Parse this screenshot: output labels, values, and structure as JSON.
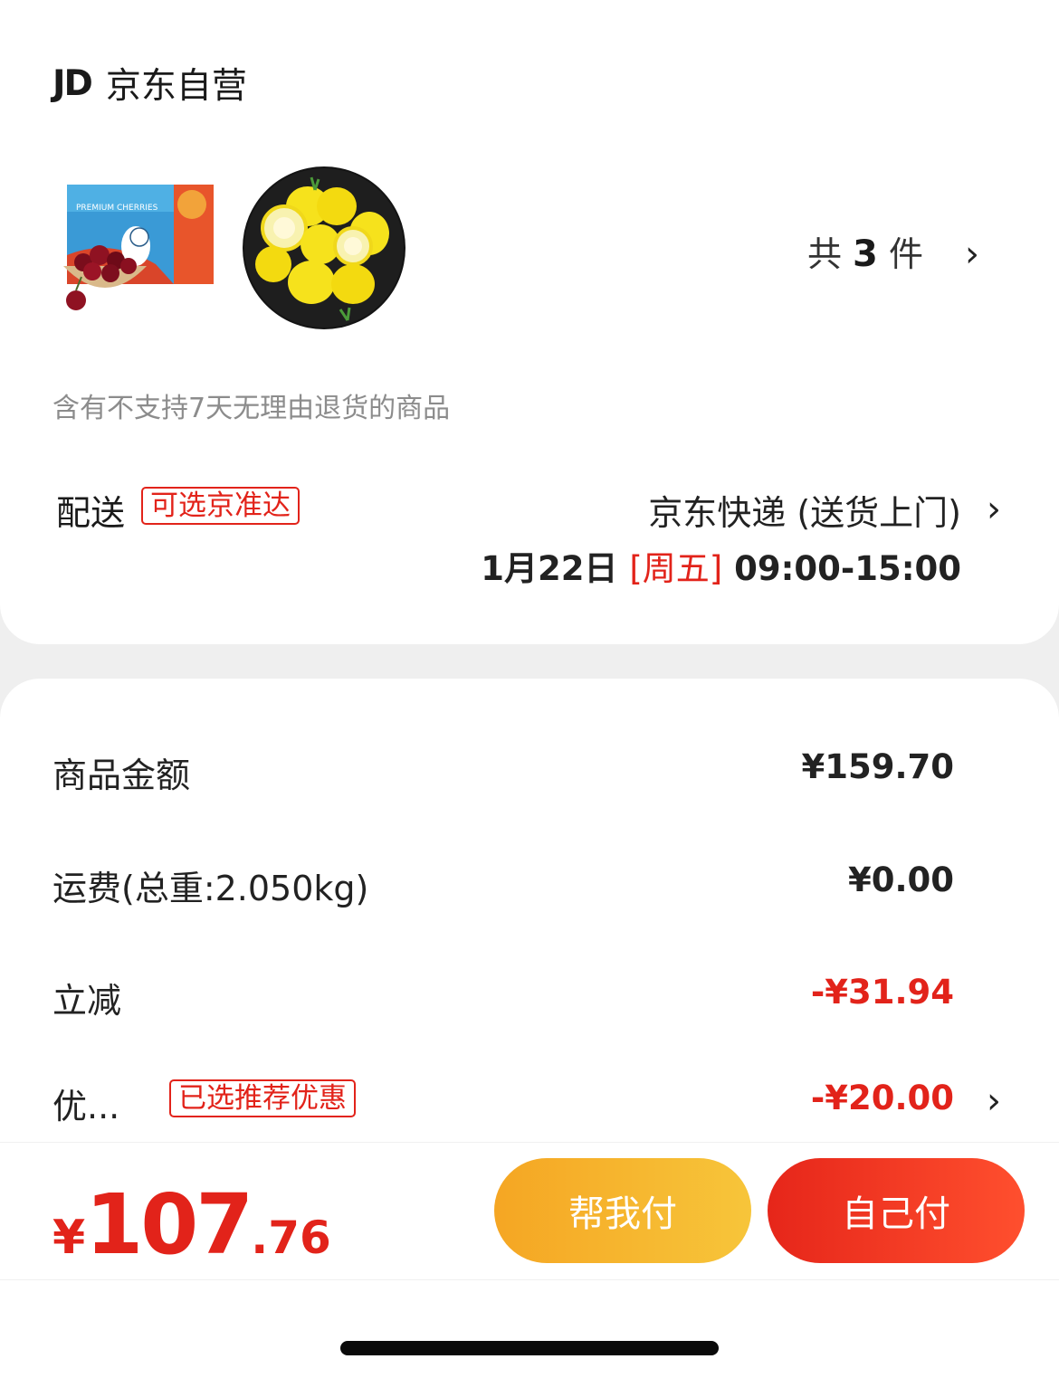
{
  "store": {
    "logo": "JD",
    "name": "京东自营",
    "items": [
      {
        "image": "cherries-box",
        "icon": "cherries-product-image",
        "box_text": "PREMIUM CHERRIES"
      },
      {
        "image": "lemons-plate",
        "icon": "lemons-product-image"
      }
    ],
    "count_prefix": "共",
    "count": "3",
    "count_suffix": "件",
    "return_note": "含有不支持7天无理由退货的商品"
  },
  "delivery": {
    "label": "配送",
    "tag": "可选京准达",
    "method": "京东快递 (送货上门)",
    "date": "1月22日",
    "weekday": "[周五]",
    "time_window": "09:00-15:00"
  },
  "price_rows": {
    "goods": {
      "label": "商品金额",
      "value": "¥159.70"
    },
    "freight": {
      "label": "运费(总重:2.050kg)",
      "value": "¥0.00"
    },
    "discount": {
      "label": "立减",
      "value": "-¥31.94"
    },
    "coupon": {
      "label": "优...",
      "tag": "已选推荐优惠",
      "value": "-¥20.00"
    }
  },
  "bottom": {
    "currency": "¥",
    "total_int": "107",
    "total_dec": ".76",
    "help_pay_label": "帮我付",
    "self_pay_label": "自己付"
  },
  "colors": {
    "accent_red": "#e2231a",
    "help_pay_gradient": [
      "#f5a623",
      "#f7c53a"
    ],
    "self_pay_gradient": [
      "#e6261a",
      "#ff4f2e"
    ],
    "background": "#efefef"
  },
  "icons": {
    "chevron": "›"
  }
}
